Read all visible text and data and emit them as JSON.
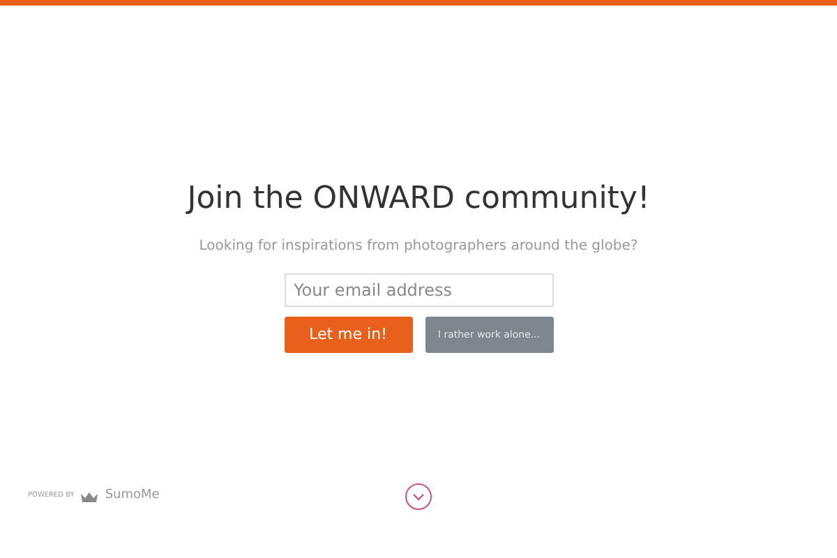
{
  "title": "Join the ONWARD community!",
  "subtitle": "Looking for inspirations from photographers around the globe?",
  "email_field": {
    "placeholder": "Your email address"
  },
  "buttons": [
    {
      "label": "Let me in!",
      "kind": "primary"
    },
    {
      "label": "I rather work alone...",
      "kind": "secondary"
    }
  ],
  "footer": {
    "powered_by": "POWERED BY",
    "brand": "SumoMe"
  }
}
